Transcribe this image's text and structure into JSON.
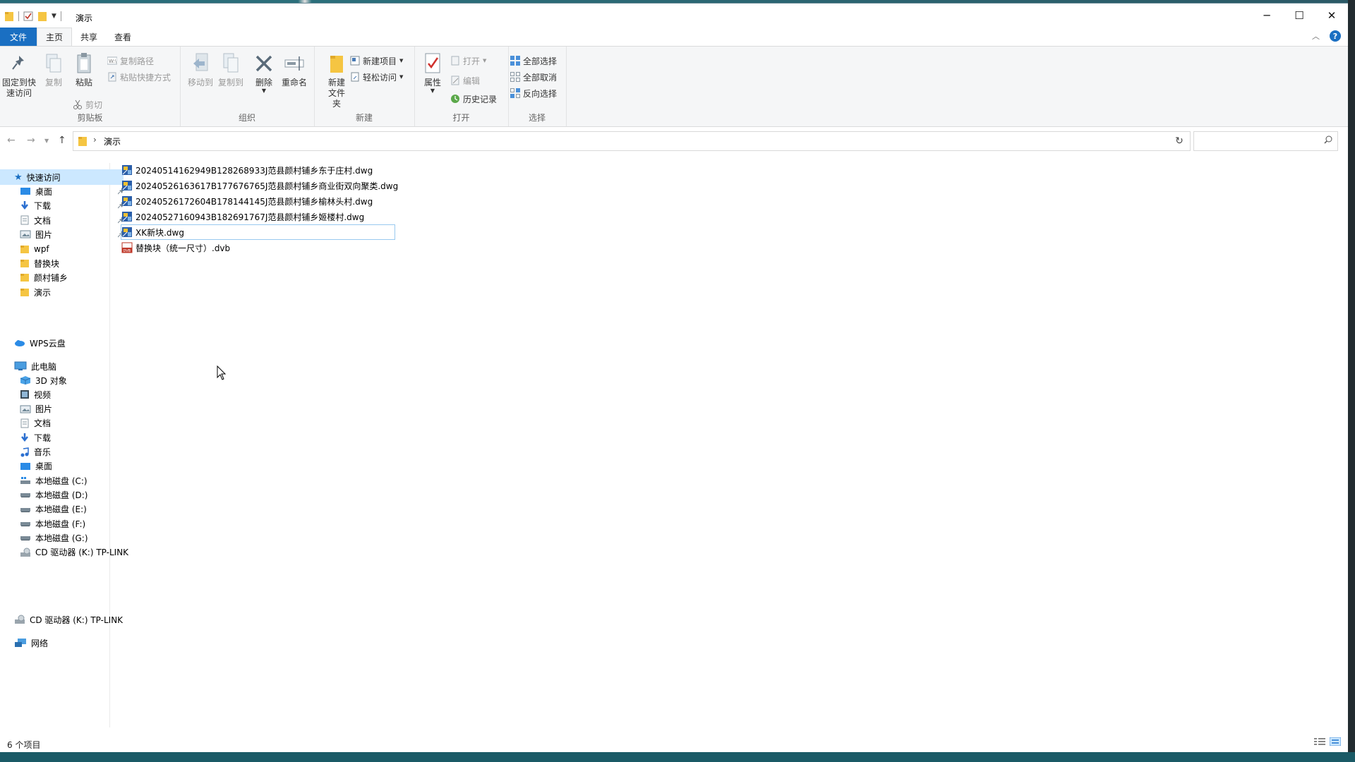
{
  "window": {
    "title": "演示"
  },
  "ribbon_tabs": {
    "file": "文件",
    "home": "主页",
    "share": "共享",
    "view": "查看"
  },
  "clipboard": {
    "pin_label": "固定到快速访问",
    "copy_label": "复制",
    "paste_label": "粘贴",
    "copy_path_label": "复制路径",
    "paste_shortcut_label": "粘贴快捷方式",
    "cut_label": "剪切",
    "group_label": "剪贴板"
  },
  "organize": {
    "move_to_label": "移动到",
    "copy_to_label": "复制到",
    "delete_label": "删除",
    "rename_label": "重命名",
    "group_label": "组织"
  },
  "new_group": {
    "new_folder_label": "新建文件夹",
    "new_item_label": "新建项目",
    "easy_access_label": "轻松访问",
    "group_label": "新建"
  },
  "open_group": {
    "properties_label": "属性",
    "open_label": "打开",
    "edit_label": "编辑",
    "history_label": "历史记录",
    "group_label": "打开"
  },
  "select_group": {
    "select_all_label": "全部选择",
    "select_none_label": "全部取消",
    "invert_label": "反向选择",
    "group_label": "选择"
  },
  "address": {
    "crumb": "演示",
    "search_placeholder": ""
  },
  "nav": {
    "quick_access": "快速访问",
    "quick_items": [
      "桌面",
      "下载",
      "文档",
      "图片",
      "wpf",
      "替换块",
      "颜村铺乡",
      "演示"
    ],
    "wps_cloud": "WPS云盘",
    "this_pc": "此电脑",
    "pc_items": [
      "3D 对象",
      "视频",
      "图片",
      "文档",
      "下载",
      "音乐",
      "桌面",
      "本地磁盘 (C:)",
      "本地磁盘 (D:)",
      "本地磁盘 (E:)",
      "本地磁盘 (F:)",
      "本地磁盘 (G:)",
      "CD 驱动器 (K:) TP-LINK"
    ],
    "cd_drive": "CD 驱动器 (K:) TP-LINK",
    "network": "网络"
  },
  "files": [
    "20240514162949B128268933J范县颜村铺乡东于庄村.dwg",
    "20240526163617B177676765J范县颜村铺乡商业街双向聚类.dwg",
    "20240526172604B178144145J范县颜村铺乡榆林头村.dwg",
    "20240527160943B182691767J范县颜村铺乡姬楼村.dwg",
    "XK新块.dwg",
    "替换块（统一尺寸）.dvb"
  ],
  "status": {
    "item_count": "6 个项目"
  },
  "colors": {
    "accent": "#1a6fc2",
    "selection": "#cce8ff",
    "folder": "#f5c542"
  }
}
